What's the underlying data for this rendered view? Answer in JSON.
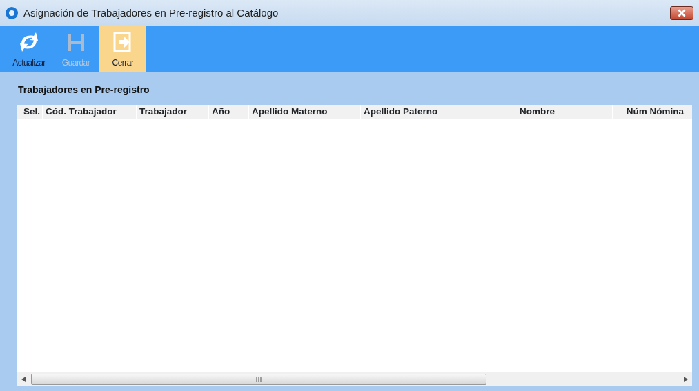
{
  "window": {
    "title": "Asignación de Trabajadores en Pre-registro al Catálogo"
  },
  "toolbar": [
    {
      "label": "Actualizar",
      "kind": "refresh",
      "disabled": false,
      "selected": false
    },
    {
      "label": "Guardar",
      "kind": "save",
      "disabled": true,
      "selected": false
    },
    {
      "label": "Cerrar",
      "kind": "exit",
      "disabled": false,
      "selected": true
    }
  ],
  "section": {
    "title": "Trabajadores en Pre-registro"
  },
  "table": {
    "columns": [
      {
        "label": "Sel."
      },
      {
        "label": "Cód. Trabajador"
      },
      {
        "label": "Trabajador"
      },
      {
        "label": "Año"
      },
      {
        "label": "Apellido Materno"
      },
      {
        "label": "Apellido Paterno"
      },
      {
        "label": "Nombre"
      },
      {
        "label": "Núm Nómina"
      }
    ]
  }
}
